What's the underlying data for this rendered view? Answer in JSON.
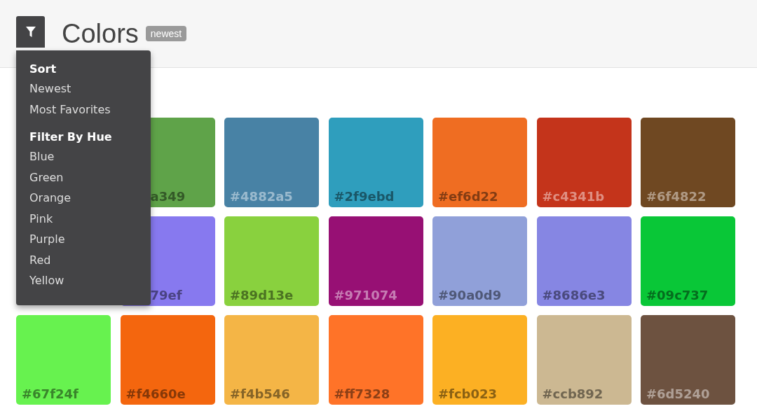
{
  "header": {
    "title": "Colors",
    "badge": "newest"
  },
  "menu": {
    "sections": [
      {
        "heading": "Sort",
        "items": [
          "Newest",
          "Most Favorites"
        ]
      },
      {
        "heading": "Filter By Hue",
        "items": [
          "Blue",
          "Green",
          "Orange",
          "Pink",
          "Purple",
          "Red",
          "Yellow"
        ]
      }
    ]
  },
  "swatch_rows": [
    [
      {
        "label": "a349",
        "color": "#5fa349",
        "cut": true
      },
      {
        "label": "#4882a5",
        "color": "#4882a5",
        "cut": false
      },
      {
        "label": "#2f9ebd",
        "color": "#2f9ebd",
        "cut": false
      },
      {
        "label": "#ef6d22",
        "color": "#ef6d22",
        "cut": false
      },
      {
        "label": "#c4341b",
        "color": "#c4341b",
        "cut": false
      },
      {
        "label": "#6f4822",
        "color": "#6f4822",
        "cut": false
      }
    ],
    [
      {
        "label": "79ef",
        "color": "#8779ef",
        "cut": true
      },
      {
        "label": "#89d13e",
        "color": "#89d13e",
        "cut": false
      },
      {
        "label": "#971074",
        "color": "#971074",
        "cut": false
      },
      {
        "label": "#90a0d9",
        "color": "#90a0d9",
        "cut": false
      },
      {
        "label": "#8686e3",
        "color": "#8686e3",
        "cut": false
      },
      {
        "label": "#09c737",
        "color": "#09c737",
        "cut": false
      }
    ],
    [
      {
        "label": "#67f24f",
        "color": "#67f24f",
        "cut": false
      },
      {
        "label": "#f4660e",
        "color": "#f4660e",
        "cut": false
      },
      {
        "label": "#f4b546",
        "color": "#f4b546",
        "cut": false
      },
      {
        "label": "#ff7328",
        "color": "#ff7328",
        "cut": false
      },
      {
        "label": "#fcb023",
        "color": "#fcb023",
        "cut": false
      },
      {
        "label": "#ccb892",
        "color": "#ccb892",
        "cut": false
      },
      {
        "label": "#6d5240",
        "color": "#6d5240",
        "cut": false
      }
    ]
  ]
}
